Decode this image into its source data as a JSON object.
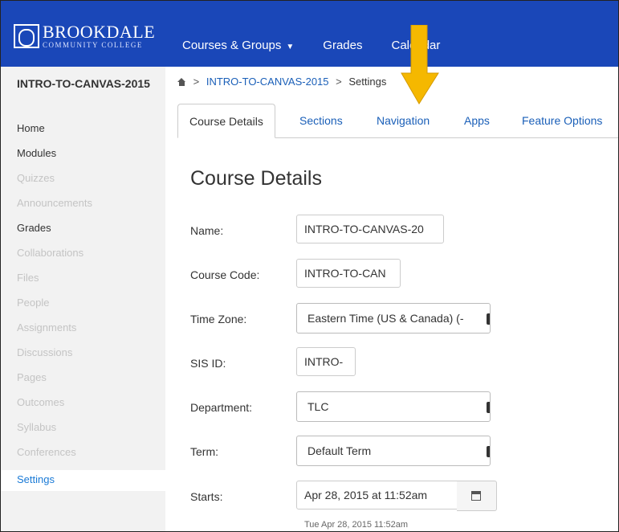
{
  "header": {
    "logo_name": "BROOKDALE",
    "logo_sub": "COMMUNITY COLLEGE",
    "nav": [
      "Courses & Groups",
      "Grades",
      "Calendar"
    ],
    "bg_color": "#1a47b8"
  },
  "sidebar": {
    "course_title": "INTRO-TO-CANVAS-2015",
    "items": [
      {
        "label": "Home",
        "state": "enabled"
      },
      {
        "label": "Modules",
        "state": "enabled"
      },
      {
        "label": "Quizzes",
        "state": "disabled"
      },
      {
        "label": "Announcements",
        "state": "disabled"
      },
      {
        "label": "Grades",
        "state": "enabled"
      },
      {
        "label": "Collaborations",
        "state": "disabled"
      },
      {
        "label": "Files",
        "state": "disabled"
      },
      {
        "label": "People",
        "state": "disabled"
      },
      {
        "label": "Assignments",
        "state": "disabled"
      },
      {
        "label": "Discussions",
        "state": "disabled"
      },
      {
        "label": "Pages",
        "state": "disabled"
      },
      {
        "label": "Outcomes",
        "state": "disabled"
      },
      {
        "label": "Syllabus",
        "state": "disabled"
      },
      {
        "label": "Conferences",
        "state": "disabled"
      },
      {
        "label": "Settings",
        "state": "active"
      }
    ]
  },
  "breadcrumb": {
    "course": "INTRO-TO-CANVAS-2015",
    "current": "Settings",
    "separator": ">"
  },
  "tabs": [
    "Course Details",
    "Sections",
    "Navigation",
    "Apps",
    "Feature Options"
  ],
  "main": {
    "section_title": "Course Details",
    "fields": {
      "name_label": "Name:",
      "name_value": "INTRO-TO-CANVAS-20",
      "code_label": "Course Code:",
      "code_value": "INTRO-TO-CAN",
      "timezone_label": "Time Zone:",
      "timezone_value": "Eastern Time (US & Canada) (-",
      "sis_label": "SIS ID:",
      "sis_value": "INTRO-",
      "department_label": "Department:",
      "department_value": "TLC",
      "term_label": "Term:",
      "term_value": "Default Term",
      "starts_label": "Starts:",
      "starts_value": "Apr 28, 2015 at 11:52am",
      "starts_hint": "Tue Apr 28, 2015 11:52am"
    }
  },
  "colors": {
    "link": "#1a5fb8",
    "arrow": "#f5b800",
    "active_nav": "#1a7ad6"
  },
  "icons": [
    "home-icon",
    "calendar-icon",
    "chevron-down-icon",
    "callout-arrow"
  ]
}
